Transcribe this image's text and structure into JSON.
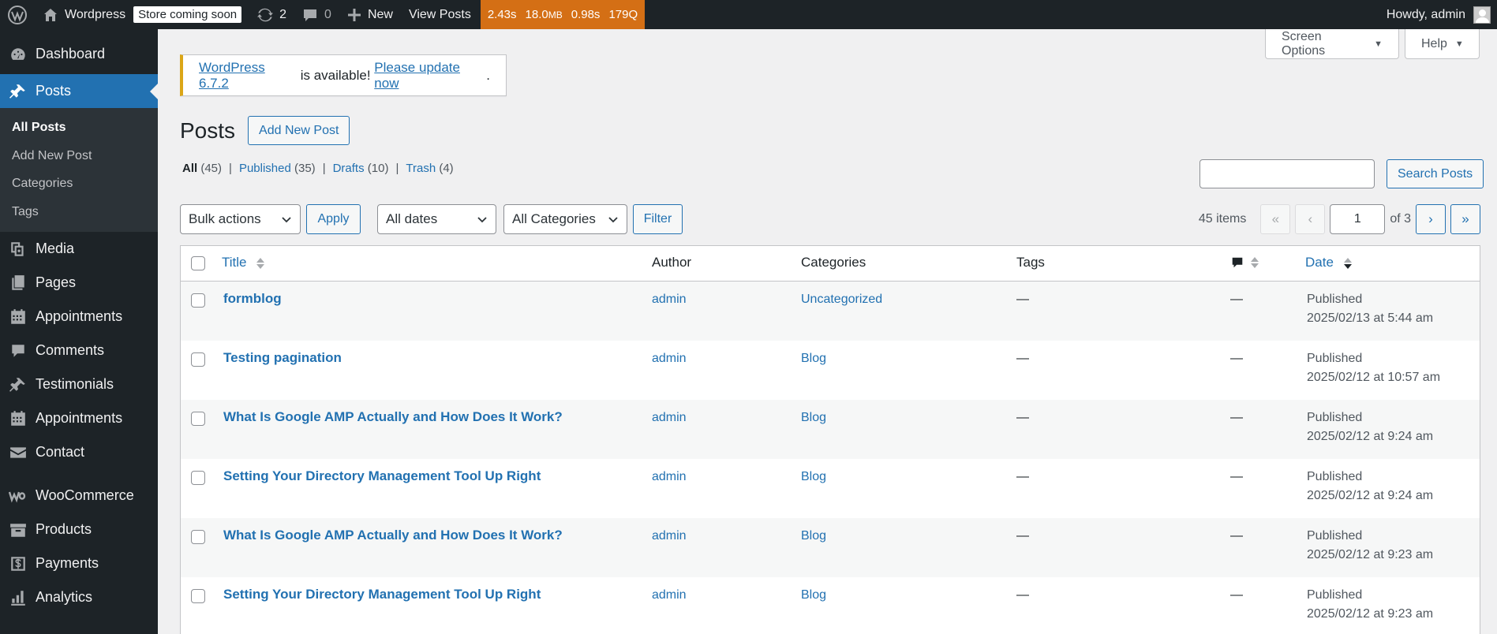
{
  "adminbar": {
    "site_name": "Wordpress",
    "store_badge": "Store coming soon",
    "updates_count": "2",
    "comments_count": "0",
    "new_label": "New",
    "view_posts": "View Posts",
    "perf_time": "2.43s",
    "perf_mem": "18.0",
    "perf_mem_unit": "MB",
    "perf_query_time": "0.98s",
    "perf_queries": "179Q",
    "howdy": "Howdy, admin"
  },
  "sidebar": {
    "items": [
      {
        "label": "Dashboard",
        "icon": "dashboard-icon"
      },
      {
        "label": "Posts",
        "icon": "pin-icon"
      },
      {
        "label": "Media",
        "icon": "media-icon"
      },
      {
        "label": "Pages",
        "icon": "pages-icon"
      },
      {
        "label": "Appointments",
        "icon": "calendar-icon"
      },
      {
        "label": "Comments",
        "icon": "comment-icon"
      },
      {
        "label": "Testimonials",
        "icon": "pin-icon"
      },
      {
        "label": "Appointments",
        "icon": "calendar-icon"
      },
      {
        "label": "Contact",
        "icon": "mail-icon"
      },
      {
        "label": "WooCommerce",
        "icon": "woo-icon"
      },
      {
        "label": "Products",
        "icon": "archive-icon"
      },
      {
        "label": "Payments",
        "icon": "dollar-icon"
      },
      {
        "label": "Analytics",
        "icon": "bar-chart-icon"
      }
    ],
    "submenu": [
      "All Posts",
      "Add New Post",
      "Categories",
      "Tags"
    ]
  },
  "screen_options": "Screen Options",
  "help": "Help",
  "notice": {
    "version_link": "WordPress 6.7.2",
    "middle_text": " is available! ",
    "update_link": "Please update now",
    "end": "."
  },
  "page": {
    "title": "Posts",
    "add_new": "Add New Post"
  },
  "filters": {
    "all": "All",
    "all_count": "(45)",
    "published": "Published",
    "published_count": "(35)",
    "drafts": "Drafts",
    "drafts_count": "(10)",
    "trash": "Trash",
    "trash_count": "(4)",
    "separator": "|"
  },
  "search": {
    "button": "Search Posts",
    "value": ""
  },
  "tablenav": {
    "bulk_actions": "Bulk actions",
    "apply": "Apply",
    "all_dates": "All dates",
    "all_categories": "All Categories",
    "filter": "Filter",
    "items_count": "45 items",
    "first": "«",
    "prev": "‹",
    "current_page": "1",
    "of_pages": "of 3",
    "next": "›",
    "last": "»"
  },
  "table": {
    "columns": {
      "title": "Title",
      "author": "Author",
      "categories": "Categories",
      "tags": "Tags",
      "comments_icon": "comment-icon",
      "date": "Date"
    },
    "rows": [
      {
        "title": "formblog",
        "author": "admin",
        "category": "Uncategorized",
        "tags": "—",
        "comments": "—",
        "status": "Published",
        "date": "2025/02/13 at 5:44 am"
      },
      {
        "title": "Testing pagination",
        "author": "admin",
        "category": "Blog",
        "tags": "—",
        "comments": "—",
        "status": "Published",
        "date": "2025/02/12 at 10:57 am"
      },
      {
        "title": "What Is Google AMP Actually and How Does It Work?",
        "author": "admin",
        "category": "Blog",
        "tags": "—",
        "comments": "—",
        "status": "Published",
        "date": "2025/02/12 at 9:24 am"
      },
      {
        "title": "Setting Your Directory Management Tool Up Right",
        "author": "admin",
        "category": "Blog",
        "tags": "—",
        "comments": "—",
        "status": "Published",
        "date": "2025/02/12 at 9:24 am"
      },
      {
        "title": "What Is Google AMP Actually and How Does It Work?",
        "author": "admin",
        "category": "Blog",
        "tags": "—",
        "comments": "—",
        "status": "Published",
        "date": "2025/02/12 at 9:23 am"
      },
      {
        "title": "Setting Your Directory Management Tool Up Right",
        "author": "admin",
        "category": "Blog",
        "tags": "—",
        "comments": "—",
        "status": "Published",
        "date": "2025/02/12 at 9:23 am"
      }
    ]
  },
  "colors": {
    "adminbar_bg": "#1d2327",
    "accent": "#2271b1",
    "perf_bg": "#d46f15",
    "notice_border": "#dba617"
  }
}
